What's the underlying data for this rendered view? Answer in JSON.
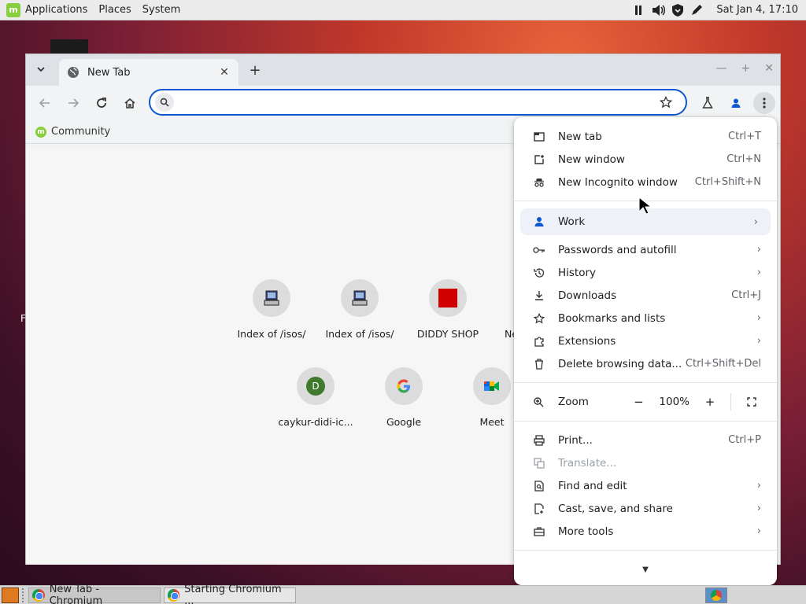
{
  "top_panel": {
    "menus": [
      "Applications",
      "Places",
      "System"
    ],
    "clock": "Sat Jan  4, 17:10"
  },
  "browser": {
    "tab": {
      "title": "New Tab"
    },
    "omnibox": {
      "value": "",
      "placeholder": ""
    },
    "bookmarks": [
      {
        "label": "Community"
      }
    ],
    "shortcuts": [
      {
        "label": "Index of /isos/",
        "icon": "computer-icon"
      },
      {
        "label": "Index of /isos/",
        "icon": "computer-icon"
      },
      {
        "label": "DIDDY SHOP",
        "icon": "red-square-icon"
      },
      {
        "label": "Ne",
        "icon": "partial"
      },
      {
        "label": "caykur-didi-ic...",
        "icon": "letter-d",
        "letter": "D"
      },
      {
        "label": "Google",
        "icon": "google-icon"
      },
      {
        "label": "Meet",
        "icon": "meet-icon"
      }
    ]
  },
  "menu": {
    "items": [
      {
        "label": "New tab",
        "shortcut": "Ctrl+T"
      },
      {
        "label": "New window",
        "shortcut": "Ctrl+N"
      },
      {
        "label": "New Incognito window",
        "shortcut": "Ctrl+Shift+N"
      },
      {
        "label": "Work"
      },
      {
        "label": "Passwords and autofill"
      },
      {
        "label": "History"
      },
      {
        "label": "Downloads",
        "shortcut": "Ctrl+J"
      },
      {
        "label": "Bookmarks and lists"
      },
      {
        "label": "Extensions"
      },
      {
        "label": "Delete browsing data...",
        "shortcut": "Ctrl+Shift+Del"
      },
      {
        "label": "Zoom"
      },
      {
        "label": "Print...",
        "shortcut": "Ctrl+P"
      },
      {
        "label": "Translate..."
      },
      {
        "label": "Find and edit"
      },
      {
        "label": "Cast, save, and share"
      },
      {
        "label": "More tools"
      }
    ],
    "zoom": {
      "value": "100%",
      "minus": "−",
      "plus": "+"
    }
  },
  "taskbar": {
    "tasks": [
      {
        "label": "New Tab - Chromium"
      },
      {
        "label": "Starting Chromium ..."
      }
    ]
  },
  "colors": {
    "accent": "#0b57d0",
    "menu_bg": "#ffffff",
    "profile_bg": "#eef2f8"
  }
}
